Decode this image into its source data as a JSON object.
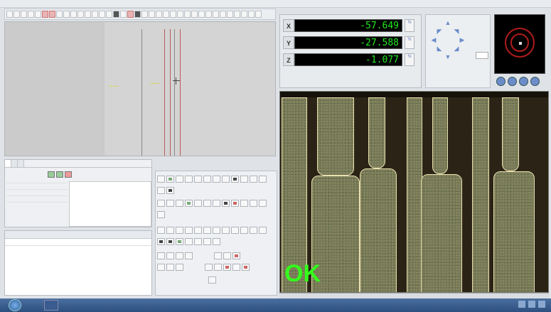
{
  "dro": {
    "x_label": "X",
    "y_label": "Y",
    "z_label": "Z",
    "x_value": "-57.649",
    "y_value": "-27.588",
    "z_value": "-1.077",
    "half_label": "½"
  },
  "camera": {
    "status_text": "OK"
  },
  "colors": {
    "dro_text": "#22e822",
    "ok_text": "#34ff1c",
    "radar_ring": "#b01c1c",
    "trace_edge": "#e9e0b0"
  }
}
